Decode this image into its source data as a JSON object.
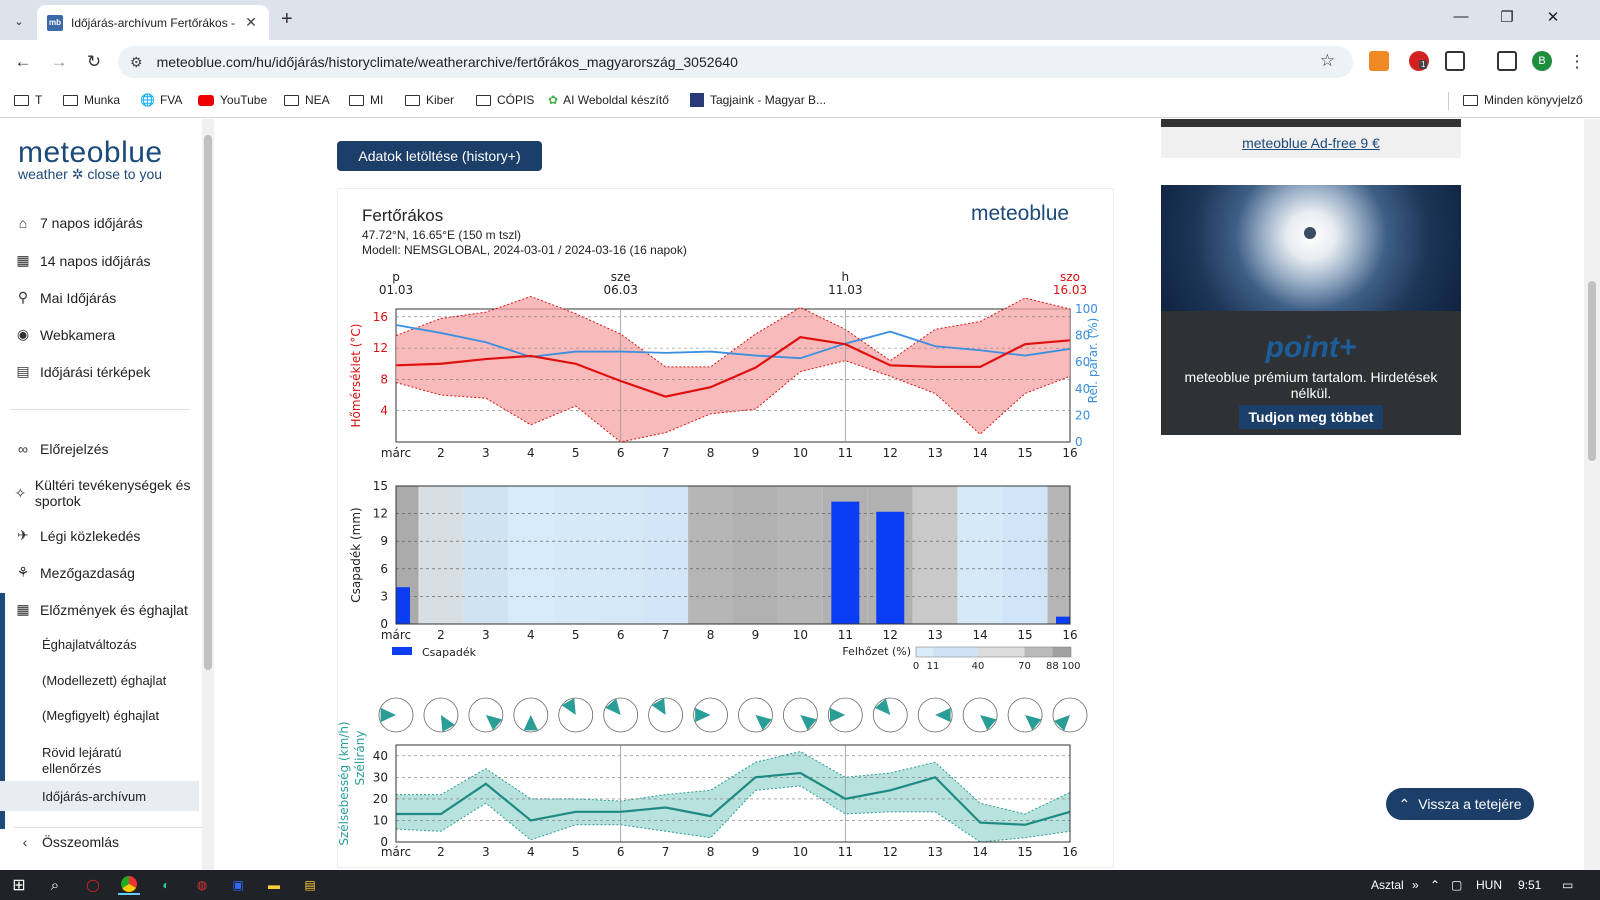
{
  "browser": {
    "tab_title": "Időjárás-archívum Fertőrákos -",
    "tab_icon": "mb",
    "url": "meteoblue.com/hu/időjárás/historyclimate/weatherarchive/fertőrákos_magyarország_3052640",
    "bookmarks": [
      "T",
      "Munka",
      "FVA",
      "YouTube",
      "NEA",
      "MI",
      "Kiber",
      "CÓPIS",
      "AI Weboldal készítő",
      "Tagjaink - Magyar B..."
    ],
    "all_bookmarks": "Minden könyvjelző",
    "profile_letter": "B",
    "ext_badge": "1"
  },
  "sidebar": {
    "logo_main": "meteoblue",
    "logo_sub": "weather ✲ close to you",
    "items": [
      "7 napos időjárás",
      "14 napos időjárás",
      "Mai Időjárás",
      "Webkamera",
      "Időjárási térképek",
      "Előrejelzés",
      "Kültéri tevékenységek és sportok",
      "Légi közlekedés",
      "Mezőgazdaság",
      "Előzmények és éghajlat"
    ],
    "sub_items": [
      "Éghajlatváltozás",
      "(Modellezett) éghajlat",
      "(Megfigyelt) éghajlat",
      "Rövid lejáratú ellenőrzés",
      "Időjárás-archívum"
    ],
    "collapse": "Összeomlás"
  },
  "main": {
    "download_button": "Adatok letöltése (history+)",
    "location_title": "Fertőrákos",
    "coords": "47.72°N, 16.65°E (150 m tszl)",
    "model": "Modell: NEMSGLOBAL, 2024-03-01 / 2024-03-16 (16 napok)",
    "brand": "meteoblue"
  },
  "chart_data": [
    {
      "type": "line",
      "x": [
        1,
        2,
        3,
        4,
        5,
        6,
        7,
        8,
        9,
        10,
        11,
        12,
        13,
        14,
        15,
        16
      ],
      "xlabel_first": "márc",
      "top_labels": [
        {
          "day": "p",
          "date": "01.03"
        },
        {
          "day": "sze",
          "date": "06.03"
        },
        {
          "day": "h",
          "date": "11.03"
        },
        {
          "day": "szo",
          "date": "16.03"
        }
      ],
      "series": [
        {
          "name": "mean",
          "values": [
            9.8,
            10.0,
            10.6,
            11.0,
            10.0,
            7.8,
            5.8,
            7.0,
            9.5,
            13.4,
            12.5,
            9.8,
            9.6,
            9.6,
            12.5,
            13.0
          ]
        },
        {
          "name": "max",
          "values": [
            13.6,
            15.8,
            16.6,
            18.6,
            16.4,
            13.8,
            9.6,
            9.6,
            13.8,
            17.2,
            14.4,
            10.4,
            14.4,
            15.4,
            18.4,
            17.0
          ]
        },
        {
          "name": "min",
          "values": [
            7.6,
            6.0,
            5.6,
            2.2,
            4.6,
            0.0,
            1.2,
            3.6,
            4.2,
            9.0,
            10.4,
            8.4,
            6.2,
            1.0,
            6.2,
            8.4
          ]
        },
        {
          "name": "humidity",
          "values": [
            88,
            82,
            75,
            64,
            68,
            68,
            67,
            68,
            65,
            63,
            74,
            83,
            72,
            69,
            65,
            70
          ]
        }
      ],
      "ylabel": "Hőmérséklet (°C)",
      "ylabel_right": "Rel. párar. (%)",
      "yticks": [
        "4",
        "8",
        "12",
        "16"
      ],
      "yticks_right": [
        "0",
        "20",
        "40",
        "60",
        "80",
        "100"
      ],
      "ylim": [
        0,
        17
      ],
      "ylim_right": [
        0,
        100
      ]
    },
    {
      "type": "bar",
      "x": [
        1,
        2,
        3,
        4,
        5,
        6,
        7,
        8,
        9,
        10,
        11,
        12,
        13,
        14,
        15,
        16
      ],
      "xlabel_first": "márc",
      "values": [
        4.0,
        0,
        0,
        0,
        0,
        0,
        0,
        0,
        0,
        0,
        13.3,
        12.2,
        0,
        0,
        0,
        0.8
      ],
      "cloud_cover": [
        95,
        60,
        45,
        15,
        20,
        25,
        30,
        90,
        92,
        90,
        92,
        92,
        80,
        20,
        35,
        90
      ],
      "ylabel": "Csapadék (mm)",
      "yticks": [
        "0",
        "3",
        "6",
        "9",
        "12",
        "15"
      ],
      "ylim": [
        0,
        15
      ],
      "legend_precip": "Csapadék",
      "legend_cloud": "Felhőzet (%)",
      "cloud_ticks": [
        "0",
        "11",
        "40",
        "70",
        "88",
        "100"
      ]
    },
    {
      "type": "area",
      "x": [
        1,
        2,
        3,
        4,
        5,
        6,
        7,
        8,
        9,
        10,
        11,
        12,
        13,
        14,
        15,
        16
      ],
      "xlabel_first": "márc",
      "wind_dir": [
        270,
        150,
        130,
        180,
        330,
        320,
        330,
        270,
        130,
        130,
        270,
        320,
        90,
        130,
        130,
        225
      ],
      "series": [
        {
          "name": "mean",
          "values": [
            13,
            13,
            27,
            10,
            14,
            14,
            16,
            12,
            30,
            32,
            20,
            24,
            30,
            9,
            8,
            14
          ]
        },
        {
          "name": "max",
          "values": [
            22,
            22,
            34,
            20,
            20,
            19,
            22,
            24,
            37,
            42,
            30,
            32,
            37,
            18,
            13,
            23
          ]
        },
        {
          "name": "min",
          "values": [
            6,
            5,
            18,
            1,
            8,
            8,
            5,
            2,
            24,
            26,
            13,
            14,
            14,
            0,
            2,
            5
          ]
        }
      ],
      "ylabel": "Szélsebesség (km/h)",
      "ylabel2": "Szélirány",
      "yticks": [
        "0",
        "10",
        "20",
        "30",
        "40"
      ],
      "ylim": [
        0,
        45
      ]
    }
  ],
  "ads": {
    "adfree_link": "meteoblue Ad-free 9 €",
    "brand": "point+",
    "text": "meteoblue prémium tartalom. Hirdetések nélkül.",
    "button": "Tudjon meg többet"
  },
  "back_to_top": "Vissza a tetejére",
  "taskbar": {
    "desktop": "Asztal",
    "lang": "HUN",
    "time": "9:51"
  }
}
